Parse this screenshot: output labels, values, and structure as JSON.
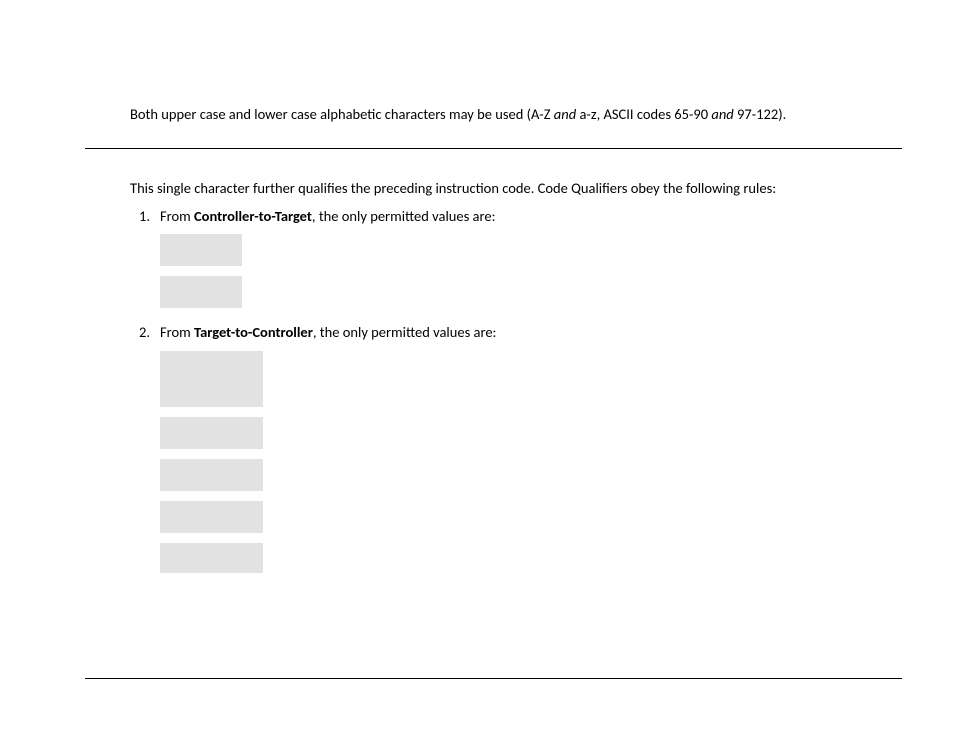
{
  "paragraph1": {
    "pre": "Both upper case and lower case alphabetic characters may be used (A-Z ",
    "and1": "and",
    "mid": " a-z, ASCII codes 65-90 ",
    "and2": "and",
    "post": " 97-122)."
  },
  "paragraph2": "This single character further qualifies the preceding instruction code. Code Qualifiers obey the following rules:",
  "list": {
    "item1": {
      "num": "1.",
      "pre": "From ",
      "bold": "Controller-to-Target",
      "post": ", the only permitted values are:"
    },
    "item2": {
      "num": "2.",
      "pre": "From ",
      "bold": "Target-to-Controller",
      "post": ", the only permitted values are:"
    }
  }
}
